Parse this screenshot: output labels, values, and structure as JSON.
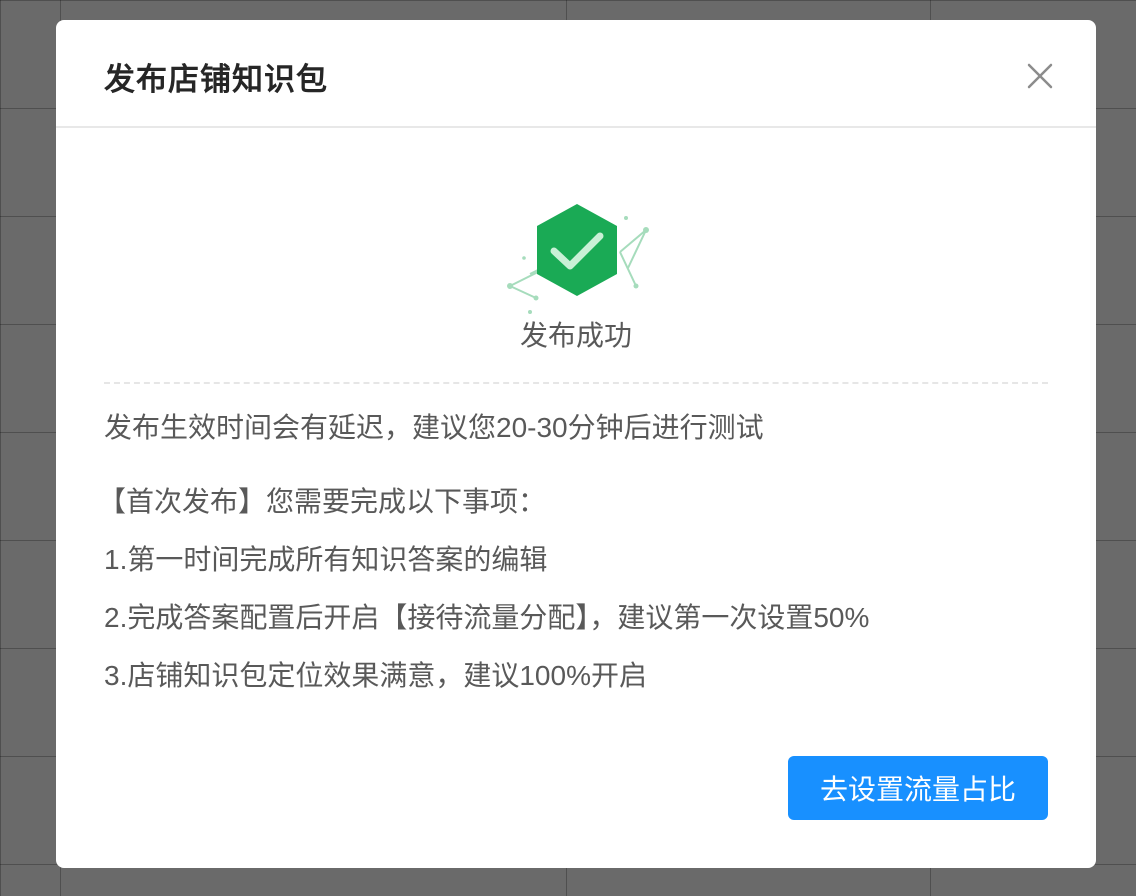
{
  "modal": {
    "title": "发布店铺知识包",
    "status_text": "发布成功",
    "notice": "发布生效时间会有延迟，建议您20-30分钟后进行测试",
    "first_publish_heading": "【首次发布】您需要完成以下事项：",
    "steps": [
      "1.第一时间完成所有知识答案的编辑",
      "2.完成答案配置后开启【接待流量分配】，建议第一次设置50%",
      "3.店铺知识包定位效果满意，建议100%开启"
    ],
    "primary_button_label": "去设置流量占比"
  },
  "icons": {
    "close": "close-icon",
    "success": "check-hexagon-icon"
  },
  "colors": {
    "primary": "#1890ff",
    "success": "#1aaa55",
    "overlay": "#6b6b6b"
  }
}
